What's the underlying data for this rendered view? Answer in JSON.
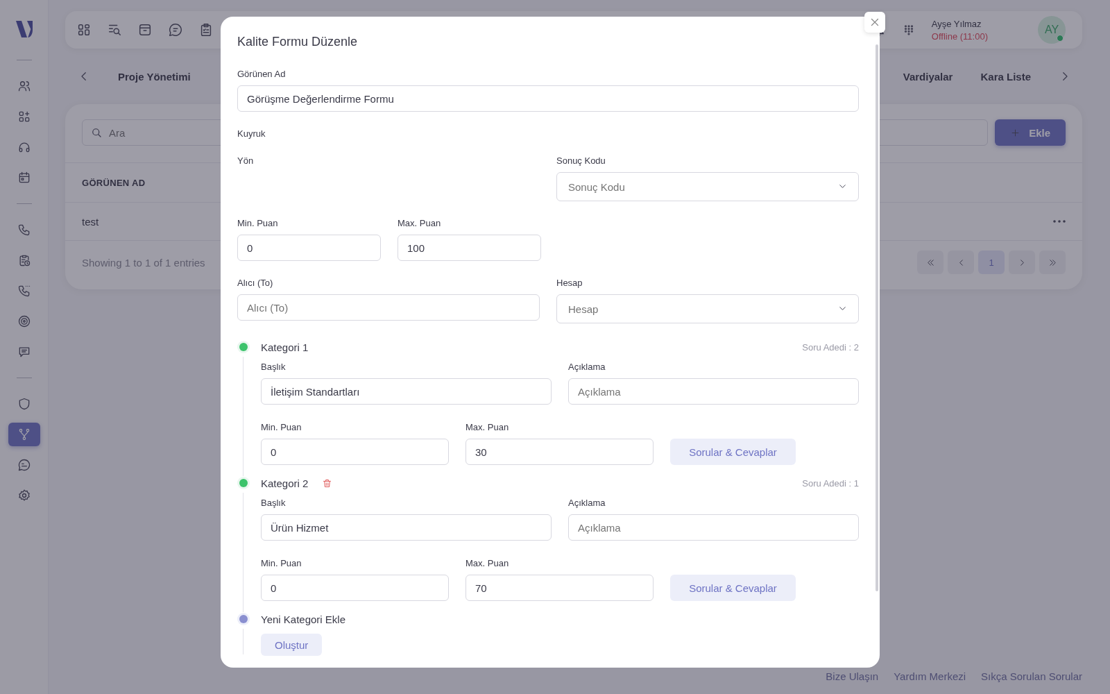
{
  "sidebar": {
    "groups": [
      {
        "items": [
          {
            "selected": false
          },
          {
            "selected": false
          },
          {
            "selected": false
          },
          {
            "selected": false
          }
        ]
      },
      {
        "items": [
          {
            "selected": false
          },
          {
            "selected": false
          },
          {
            "selected": false
          },
          {
            "selected": false
          },
          {
            "selected": false
          }
        ]
      },
      {
        "items": [
          {
            "selected": false
          },
          {
            "selected": true
          },
          {
            "selected": false
          },
          {
            "selected": false
          }
        ]
      }
    ]
  },
  "header": {
    "user": {
      "name": "Ayşe Yılmaz",
      "status": "Offline (11:00)",
      "initials": "AY",
      "online": true
    }
  },
  "tabs": [
    {
      "label": "Proje Yönetimi"
    },
    {
      "label": "Vardiyalar"
    },
    {
      "label": "Kara Liste"
    }
  ],
  "table": {
    "search": {
      "placeholder": "Ara"
    },
    "add_button": "Ekle",
    "columns": [
      "GÖRÜNEN AD"
    ],
    "rows": [
      [
        "test"
      ]
    ],
    "info": "Showing 1 to 1 of 1 entries",
    "pagination": {
      "pages": [
        {
          "label": "1",
          "selected": true
        }
      ]
    }
  },
  "footer_links": [
    "Bize Ulaşın",
    "Yardım Merkezi",
    "Sıkça Sorulan Sorular"
  ],
  "modal": {
    "title": "Kalite Formu Düzenle",
    "display_name": {
      "label": "Görünen Ad",
      "value": "Görüşme Değerlendirme Formu"
    },
    "queue": {
      "label": "Kuyruk"
    },
    "direction": {
      "label": "Yön"
    },
    "result_code": {
      "label": "Sonuç Kodu",
      "placeholder": "Sonuç Kodu"
    },
    "min_score": {
      "label": "Min. Puan",
      "value": "0"
    },
    "max_score": {
      "label": "Max. Puan",
      "value": "100"
    },
    "recipient": {
      "label": "Alıcı (To)",
      "placeholder": "Alıcı (To)"
    },
    "account": {
      "label": "Hesap",
      "placeholder": "Hesap"
    },
    "categories": [
      {
        "title": "Kategori 1",
        "color": "#3cc36b",
        "deletable": false,
        "count": "Soru Adedi : 2",
        "heading_label": "Başlık",
        "heading": "İletişim Standartları",
        "description_label": "Açıklama",
        "description_placeholder": "Açıklama",
        "min_label": "Min. Puan",
        "min": "0",
        "max_label": "Max. Puan",
        "max": "30",
        "qa_button": "Sorular & Cevaplar"
      },
      {
        "title": "Kategori 2",
        "color": "#3cc36b",
        "deletable": true,
        "count": "Soru Adedi : 1",
        "heading_label": "Başlık",
        "heading": "Ürün Hizmet",
        "description_label": "Açıklama",
        "description_placeholder": "Açıklama",
        "min_label": "Min. Puan",
        "min": "0",
        "max_label": "Max. Puan",
        "max": "70",
        "qa_button": "Sorular & Cevaplar"
      }
    ],
    "new_category": {
      "title": "Yeni Kategori Ekle",
      "button": "Oluştur"
    }
  }
}
